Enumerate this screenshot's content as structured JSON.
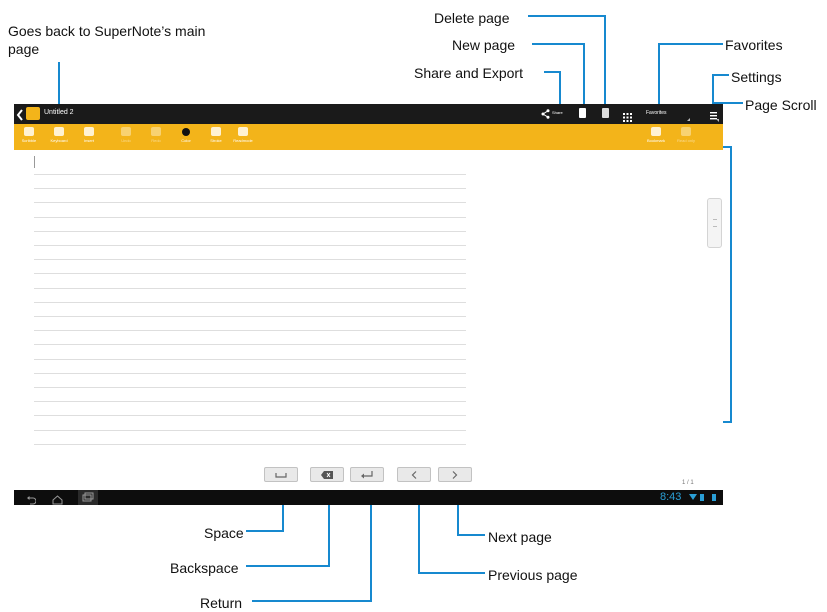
{
  "app": {
    "note_title": "Untitled 2",
    "share_label": "Share",
    "favorites_label": "Favorites",
    "page_counter": "1 / 1",
    "clock": "8:43",
    "toolbar_items": [
      "Scribble",
      "Keyboard",
      "Insert",
      "Undo",
      "Redo",
      "Color",
      "Stroke",
      "Readmode"
    ],
    "toolbar_right_items": [
      "Bookmark",
      "Read only"
    ]
  },
  "callouts": {
    "back": "Goes back to SuperNote’s main page",
    "delete_page": "Delete page",
    "new_page": "New page",
    "share_export": "Share and Export",
    "favorites": "Favorites",
    "settings": "Settings",
    "page_scroll": "Page Scroll",
    "space": "Space",
    "backspace": "Backspace",
    "return": "Return",
    "previous_page": "Previous page",
    "next_page": "Next page"
  },
  "colors": {
    "accent": "#1789cf",
    "toolbar": "#f3b41a",
    "clock": "#2a9fd6"
  },
  "icons": {
    "back": "back-arrow-icon",
    "share": "share-icon",
    "new_page": "new-page-icon",
    "delete_page": "delete-page-icon",
    "grid": "grid-icon",
    "settings": "settings-icon",
    "space": "space-icon",
    "backspace": "backspace-icon",
    "return": "return-icon",
    "previous": "chevron-left-icon",
    "next": "chevron-right-icon"
  }
}
